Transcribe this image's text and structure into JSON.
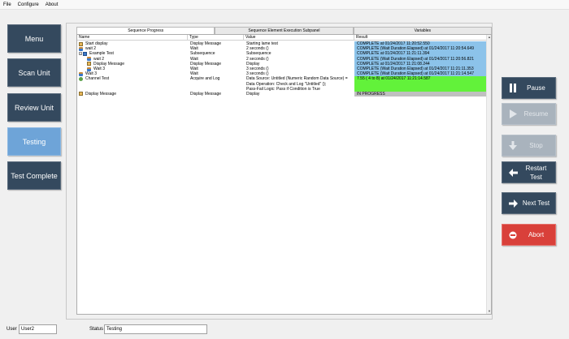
{
  "menu": {
    "items": [
      "File",
      "Configure",
      "About"
    ]
  },
  "nav": {
    "menu": "Menu",
    "scan_unit": "Scan Unit",
    "review_unit": "Review Unit",
    "testing": "Testing",
    "test_complete": "Test Complete",
    "active": "Testing"
  },
  "tabs": {
    "progress": "Sequence Progress",
    "execution": "Sequence Element Execution Subpanel",
    "variables": "Variables",
    "active": "Sequence Progress"
  },
  "table": {
    "headers": {
      "name": "Name",
      "type": "Type",
      "value": "Value",
      "result": "Result"
    },
    "rows": [
      {
        "name": "Start display",
        "type": "Display Message",
        "value": "Starting lame test",
        "result": "COMPLETE at 01/24/2017 11:20:52.550",
        "icon": "message-icon",
        "status": "blue"
      },
      {
        "name": "wait 2",
        "type": "Wait",
        "value": "2 seconds ()",
        "result": "COMPLETE (Wait Duration Elapsed) at 01/24/2017 11:20:54.649",
        "icon": "wait-icon",
        "status": "blue"
      },
      {
        "name": "Example Test",
        "type": "Subsequence",
        "value": "Subsequence",
        "result": "COMPLETE at 01/24/2017 11:21:11.394",
        "icon": "subsequence-icon",
        "status": "blue",
        "expander": "−"
      },
      {
        "name": "wait 2",
        "type": "Wait",
        "value": "2 seconds ()",
        "result": "COMPLETE (Wait Duration Elapsed) at 01/24/2017 11:20:56.821",
        "icon": "wait-icon",
        "status": "blue"
      },
      {
        "name": "Display Message",
        "type": "Display Message",
        "value": "Display",
        "result": "COMPLETE at 01/24/2017 11:21:08.244",
        "icon": "message-icon",
        "status": "blue"
      },
      {
        "name": "Wait 3",
        "type": "Wait",
        "value": "3 seconds ()",
        "result": "COMPLETE (Wait Duration Elapsed) at 01/24/2017 11:21:11.353",
        "icon": "wait-icon",
        "status": "blue"
      },
      {
        "name": "Wait 3",
        "type": "Wait",
        "value": "3 seconds ()",
        "result": "COMPLETE (Wait Duration Elapsed) at 01/24/2017 11:21:14.547",
        "icon": "wait-icon",
        "status": "blue"
      },
      {
        "name": "Channel Test",
        "type": "Acquire and Log",
        "value": "Data Source: Untitled (Numeric Random Data Source) =",
        "result": "7.55 ( 4 to 8) at 01/24/2017 11:21:14.587",
        "icon": "channel-icon",
        "status": "green"
      },
      {
        "name": "",
        "type": "",
        "value": "Data Operation: Check and Log \"Untitled\" ();",
        "result": "",
        "icon": "",
        "status": "green"
      },
      {
        "name": "",
        "type": "",
        "value": "Pass-Fail Logic: Pass if Condition is True",
        "result": "",
        "icon": "",
        "status": "green"
      },
      {
        "name": "Display Message",
        "type": "Display Message",
        "value": "Display",
        "result": "IN PROGRESS",
        "icon": "message-icon",
        "status": "gray"
      }
    ]
  },
  "actions": {
    "pause": "Pause",
    "resume": "Resume",
    "stop": "Stop",
    "restart": "Restart Test",
    "next": "Next Test",
    "abort": "Abort"
  },
  "status": {
    "user_label": "User",
    "user_value": "User2",
    "status_label": "Status",
    "status_value": "Testing"
  },
  "colors": {
    "nav": "#34495e",
    "nav_active": "#6ea4d8",
    "result_complete": "#8cc3ea",
    "result_pass": "#62f23a",
    "result_progress": "#c0c0c0",
    "abort": "#d9403a",
    "disabled": "#a9b3bd"
  }
}
